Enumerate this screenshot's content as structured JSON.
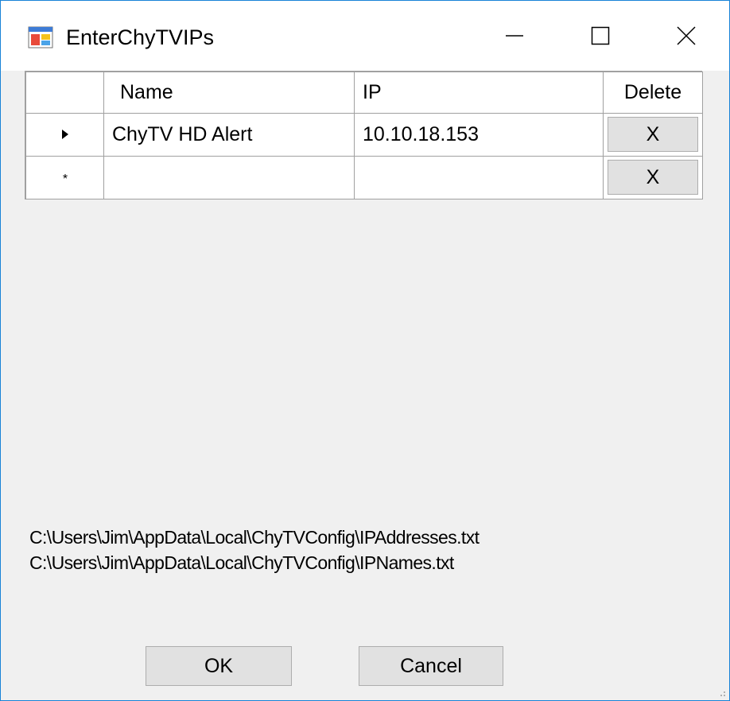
{
  "window": {
    "title": "EnterChyTVIPs",
    "icon": "winforms-app-icon",
    "controls": {
      "minimize_icon": "minimize-icon",
      "maximize_icon": "maximize-icon",
      "close_icon": "close-icon"
    }
  },
  "grid": {
    "columns": [
      "Name",
      "IP",
      "Delete"
    ],
    "rows": [
      {
        "indicator": "current-row-arrow-icon",
        "name": "ChyTV HD Alert",
        "ip": "10.10.18.153",
        "delete_label": "X"
      },
      {
        "indicator": "new-row-asterisk-icon",
        "name": "",
        "ip": "",
        "delete_label": "X"
      }
    ]
  },
  "paths": {
    "addresses_file": "C:\\Users\\Jim\\AppData\\Local\\ChyTVConfig\\IPAddresses.txt",
    "names_file": "C:\\Users\\Jim\\AppData\\Local\\ChyTVConfig\\IPNames.txt"
  },
  "buttons": {
    "ok": "OK",
    "cancel": "Cancel"
  },
  "colors": {
    "window_border": "#1883d7",
    "form_background": "#f0f0f0",
    "button_face": "#e1e1e1",
    "grid_lines": "#a0a0a0"
  }
}
